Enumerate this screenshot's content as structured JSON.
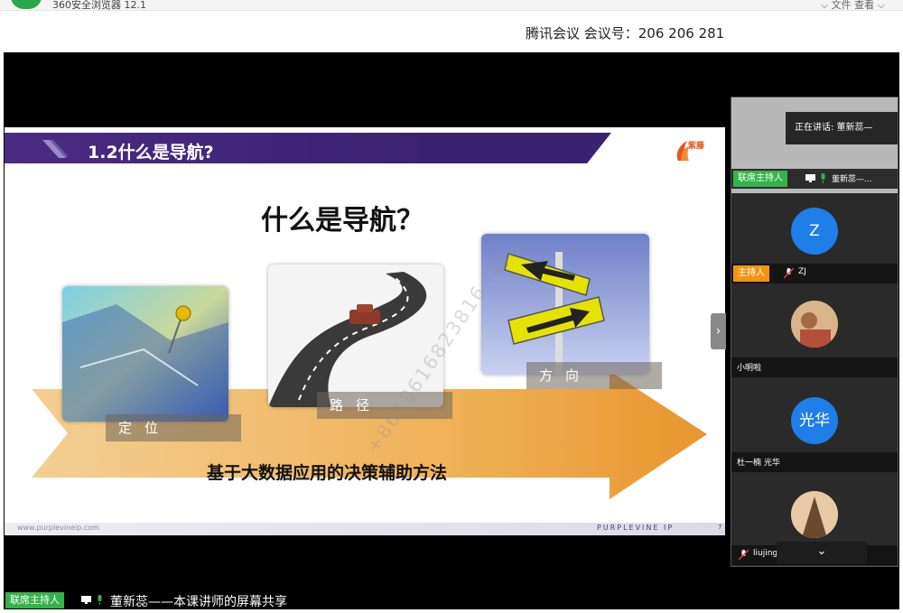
{
  "window": {
    "app_title": "360安全浏览器 12.1",
    "menu_text": "⌵  文件  查看 ⌵"
  },
  "meeting": {
    "info": "腾讯会议 会议号：206 206 281"
  },
  "slide": {
    "title": "1.2什么是导航?",
    "logo_text": "紫藤",
    "heading": "什么是导航？",
    "captions": [
      "定位",
      "路径",
      "方向"
    ],
    "subtitle": "基于大数据应用的决策辅助方法",
    "watermark": "+8618616823816 (ZJ)",
    "footer_url": "www.purplevineip.com",
    "footer_brand": "PURPLEVINE IP",
    "page_number": "7",
    "colors": {
      "header": "#3b2270",
      "arrow": "#f1b65a",
      "logo": "#e2581c"
    }
  },
  "panel": {
    "speaking": "正在讲话: 董新蕊—",
    "participants": [
      {
        "role": "联席主持人",
        "name": "董新蕊—...",
        "icons": [
          "screen-share-icon",
          "mic-icon"
        ]
      },
      {
        "avatar_text": "Z",
        "role": "主持人",
        "name": "ZJ",
        "icons": [
          "mic-muted-icon"
        ]
      },
      {
        "avatar": "photo",
        "name": "小明啦"
      },
      {
        "avatar_text": "光华",
        "name": "杜一楠 光华"
      },
      {
        "avatar": "photo",
        "name": "liujing",
        "icons": [
          "mic-muted-icon"
        ]
      }
    ],
    "scroll_icon": "chevron-down-icon",
    "next_icon": "chevron-right-icon"
  },
  "status": {
    "role": "联席主持人",
    "text": "董新蕊——本课讲师的屏幕共享",
    "colors": {
      "cohost": "#34b34a",
      "host": "#f2950f"
    }
  }
}
